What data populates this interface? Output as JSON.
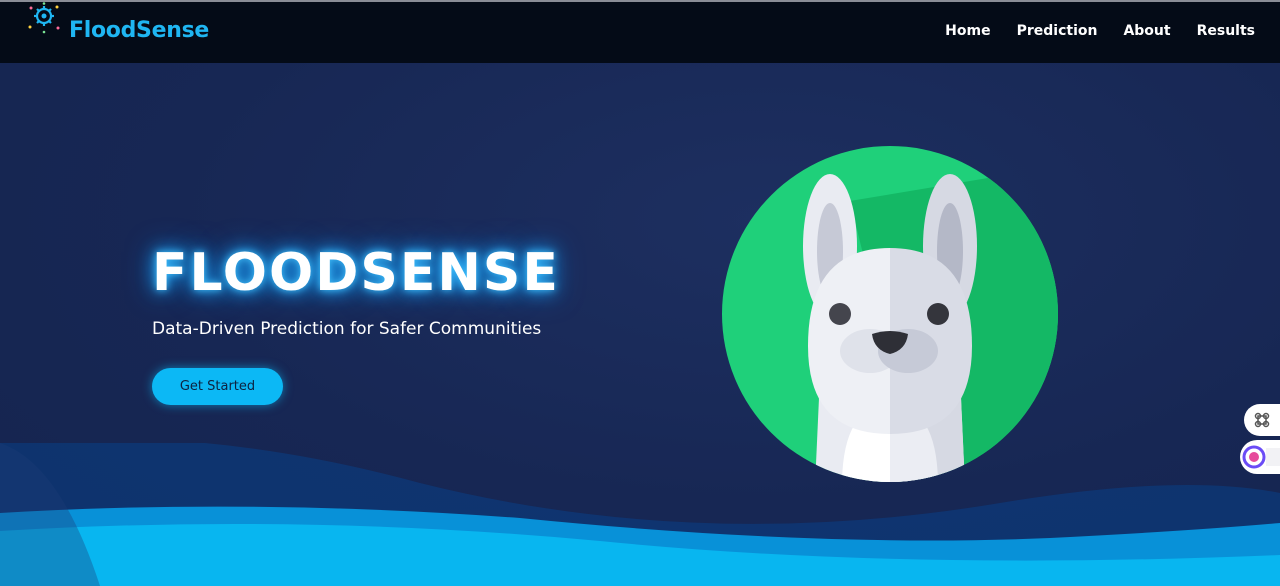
{
  "brand": {
    "name": "FloodSense"
  },
  "nav": {
    "items": [
      "Home",
      "Prediction",
      "About",
      "Results"
    ]
  },
  "hero": {
    "title": "FLOODSENSE",
    "subtitle": "Data-Driven Prediction for Safer Communities",
    "cta_label": "Get Started"
  },
  "icons": {
    "logo": "gear-network-icon",
    "illustration": "bunny-avatar",
    "side_widget_1": "command-icon",
    "side_widget_2": "assistant-icon"
  },
  "colors": {
    "brand_accent": "#1fb6f2",
    "nav_bg": "#040b17",
    "hero_bg": "#172754",
    "avatar_circle": "#1fd07a",
    "wave": "#08b6f0"
  }
}
